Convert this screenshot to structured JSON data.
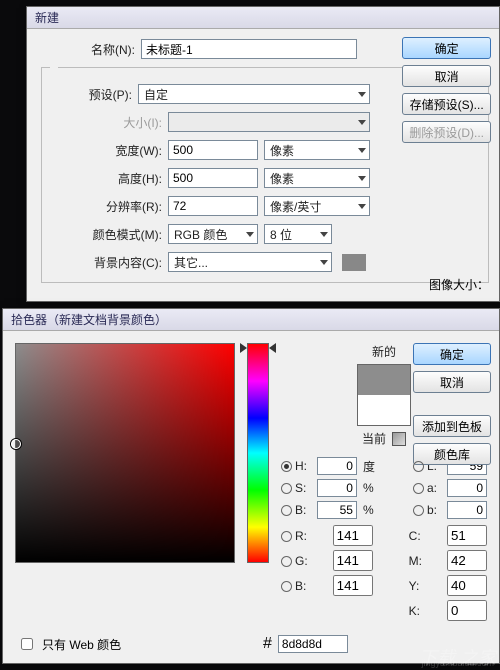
{
  "newDialog": {
    "title": "新建",
    "labels": {
      "name": "名称(N):",
      "preset": "预设(P):",
      "size": "大小(I):",
      "width": "宽度(W):",
      "height": "高度(H):",
      "resolution": "分辨率(R):",
      "colorMode": "颜色模式(M):",
      "background": "背景内容(C):",
      "imageSize": "图像大小："
    },
    "values": {
      "name": "未标题-1",
      "preset": "自定",
      "size": "",
      "width": "500",
      "height": "500",
      "resolution": "72",
      "colorMode": "RGB 颜色",
      "bits": "8 位",
      "background": "其它..."
    },
    "units": {
      "px": "像素",
      "ppi": "像素/英寸"
    },
    "buttons": {
      "ok": "确定",
      "cancel": "取消",
      "savePreset": "存储预设(S)...",
      "deletePreset": "删除预设(D)..."
    }
  },
  "picker": {
    "title": "拾色器（新建文档背景颜色）",
    "labels": {
      "new": "新的",
      "current": "当前",
      "webOnly": "只有 Web 颜色",
      "addSwatch": "添加到色板",
      "colorLib": "颜色库"
    },
    "buttons": {
      "ok": "确定",
      "cancel": "取消"
    },
    "hsb": {
      "H": "0",
      "S": "0",
      "B": "55",
      "unitDeg": "度",
      "unitPct": "%"
    },
    "lab": {
      "L": "59",
      "a": "0",
      "b": "0"
    },
    "rgb": {
      "R": "141",
      "G": "141",
      "Bv": "141"
    },
    "cmyk": {
      "C": "51",
      "M": "42",
      "Y": "40",
      "K": "0"
    },
    "hexLabel": "#",
    "hex": "8d8d8d",
    "channels": {
      "H": "H:",
      "S": "S:",
      "Bv": "B:",
      "L": "L:",
      "a": "a:",
      "b": "b:",
      "R": "R:",
      "G": "G:",
      "Bc": "B:",
      "C": "C:",
      "M": "M:",
      "Y": "Y:",
      "K": "K:"
    }
  }
}
